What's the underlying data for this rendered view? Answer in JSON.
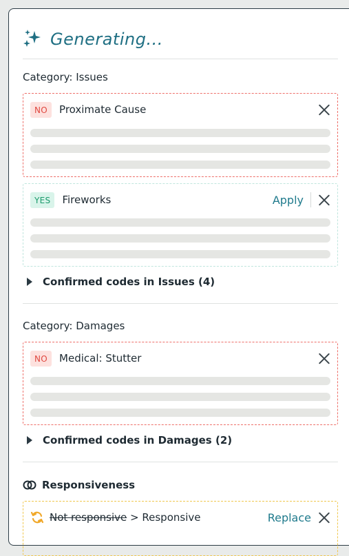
{
  "header": {
    "title": "Generating...",
    "icon": "sparkles-icon"
  },
  "categories": [
    {
      "title": "Category: Issues",
      "cards": [
        {
          "badge": "NO",
          "label": "Proximate Cause"
        },
        {
          "badge": "YES",
          "label": "Fireworks",
          "action": "Apply"
        }
      ],
      "confirmed": "Confirmed codes in Issues (4)"
    },
    {
      "title": "Category: Damages",
      "cards": [
        {
          "badge": "NO",
          "label": "Medical: Stutter"
        }
      ],
      "confirmed": "Confirmed codes in Damages (2)"
    }
  ],
  "responsiveness": {
    "title": "Responsiveness",
    "old_value": "Not responsive",
    "separator": ">",
    "new_value": "Responsive",
    "action": "Replace"
  },
  "colors": {
    "accent": "#1f6f83",
    "no_border": "#ee6e68",
    "yes_border": "#bfe5dd",
    "warn_border": "#f0c64b",
    "no_badge_text": "#e0473f",
    "yes_badge_text": "#1b9a6b"
  }
}
